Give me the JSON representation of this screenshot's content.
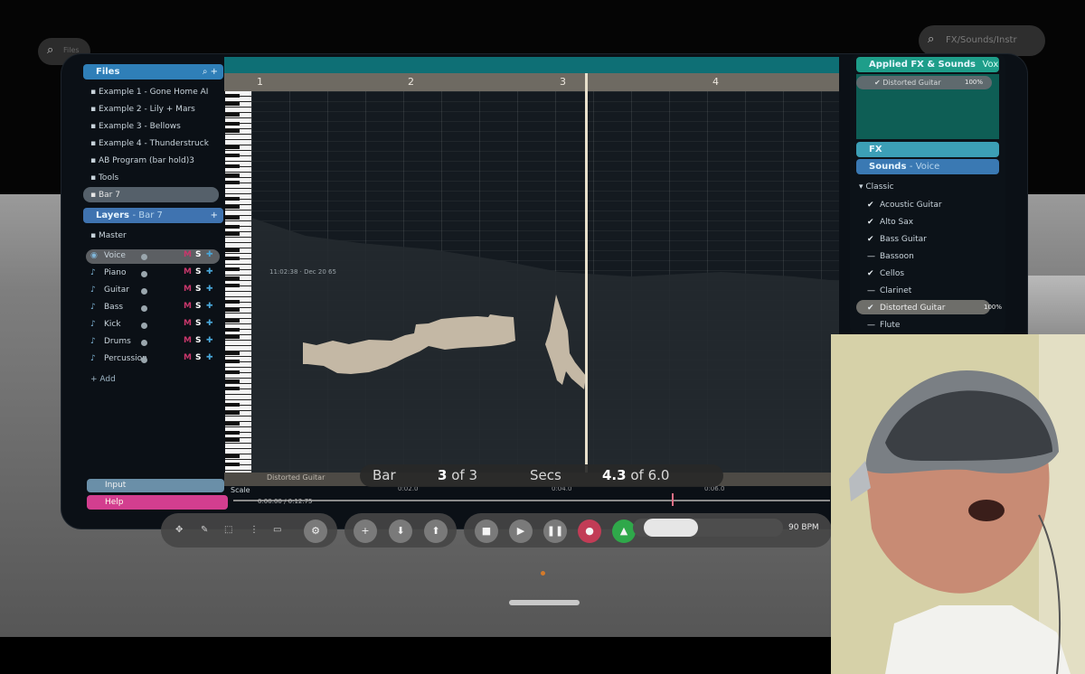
{
  "files": {
    "header": "Files",
    "items": [
      "Example 1 - Gone Home AI",
      "Example 2 - Lily + Mars",
      "Example 3 - Bellows",
      "Example 4 - Thunderstruck",
      "AB Program (bar hold)3",
      "Tools",
      "Bar 7"
    ]
  },
  "layers": {
    "header": "Layers",
    "header_sub": "- Bar 7",
    "master": "Master",
    "items": [
      {
        "name": "Voice"
      },
      {
        "name": "Piano"
      },
      {
        "name": "Guitar"
      },
      {
        "name": "Bass"
      },
      {
        "name": "Kick"
      },
      {
        "name": "Drums"
      },
      {
        "name": "Percussion"
      }
    ],
    "m": "M",
    "s": "S",
    "add": "Add",
    "input": "Input",
    "help": "Help"
  },
  "arrange": {
    "bars": [
      "1",
      "2",
      "3",
      "4"
    ],
    "time_label": "11:02:38 · Dec 20 65",
    "track_label": "Distorted Guitar",
    "scale": "Scale",
    "timeline_text": "0:00.00 / 0:12.75",
    "ticks": [
      "0:02.0",
      "0:04.0",
      "0:06.0"
    ]
  },
  "status": {
    "bar_label": "Bar",
    "bar_value": "3",
    "bar_of": "of 3",
    "secs_label": "Secs",
    "secs_value": "4.3",
    "secs_of": "of 6.0"
  },
  "fx": {
    "applied_header": "Applied FX & Sounds",
    "applied_sub": "Vox",
    "applied_item": "Distorted Guitar",
    "applied_item_val": "100%",
    "fx_header": "FX",
    "sounds_header": "Sounds",
    "sounds_sub": "- Voice",
    "group": "Classic",
    "items": [
      "Acoustic Guitar",
      "Alto Sax",
      "Bass Guitar",
      "Bassoon",
      "Cellos",
      "Clarinet",
      "Distorted Guitar",
      "Flute"
    ],
    "selected_val": "100%"
  },
  "search": {
    "left_label": "Files",
    "right_label": "FX/Sounds/Instr"
  },
  "transport": {
    "bpm": "90 BPM"
  },
  "colors": {
    "accent_teal": "#0e6f75",
    "files_blue": "#2f7fb8",
    "help_pink": "#d33e8f",
    "record_red": "#c23c56",
    "metronome_green": "#2fa84a"
  }
}
